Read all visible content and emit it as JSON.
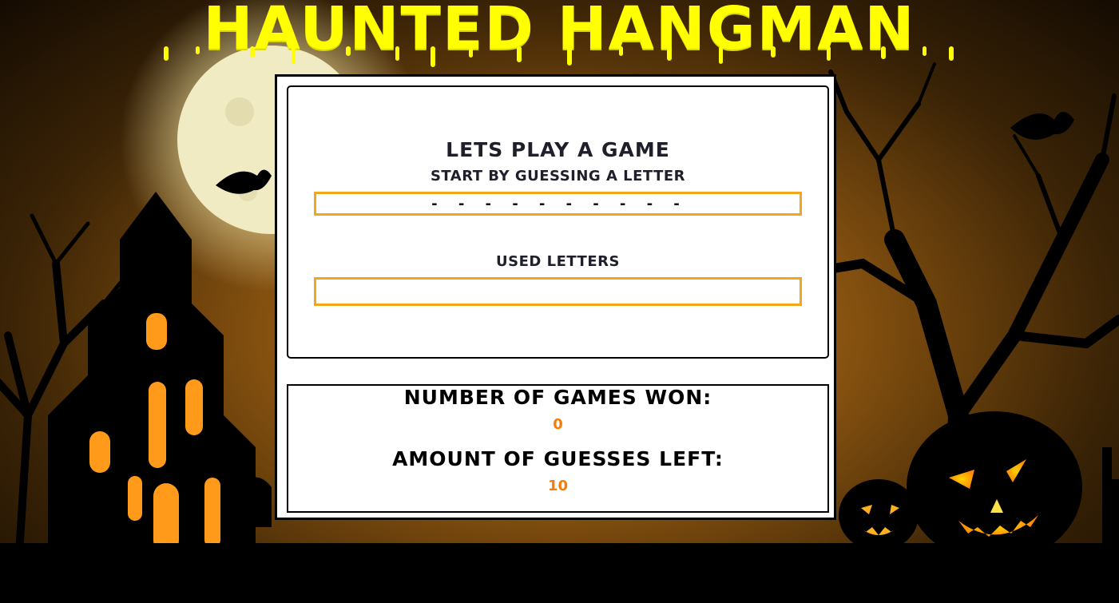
{
  "page": {
    "title": "HAUNTED HANGMAN",
    "colors": {
      "title": "#ffff00",
      "box_border": "#f3a51c",
      "value_text": "#f47c0a",
      "heading_text": "#1f1f2b"
    }
  },
  "game": {
    "heading": "LETS PLAY A GAME",
    "instruction": "START BY GUESSING A LETTER",
    "word_display": "- - - - - - - - - -",
    "used_letters_label": "USED LETTERS",
    "used_letters": ""
  },
  "scoreboard": {
    "games_won_label": "NUMBER OF GAMES WON:",
    "games_won": "0",
    "guesses_left_label": "AMOUNT OF GUESSES LEFT:",
    "guesses_left": "10"
  },
  "background": {
    "icons": [
      "full-moon",
      "haunted-house",
      "bare-trees",
      "bats",
      "jack-o-lanterns",
      "gravestones"
    ]
  }
}
